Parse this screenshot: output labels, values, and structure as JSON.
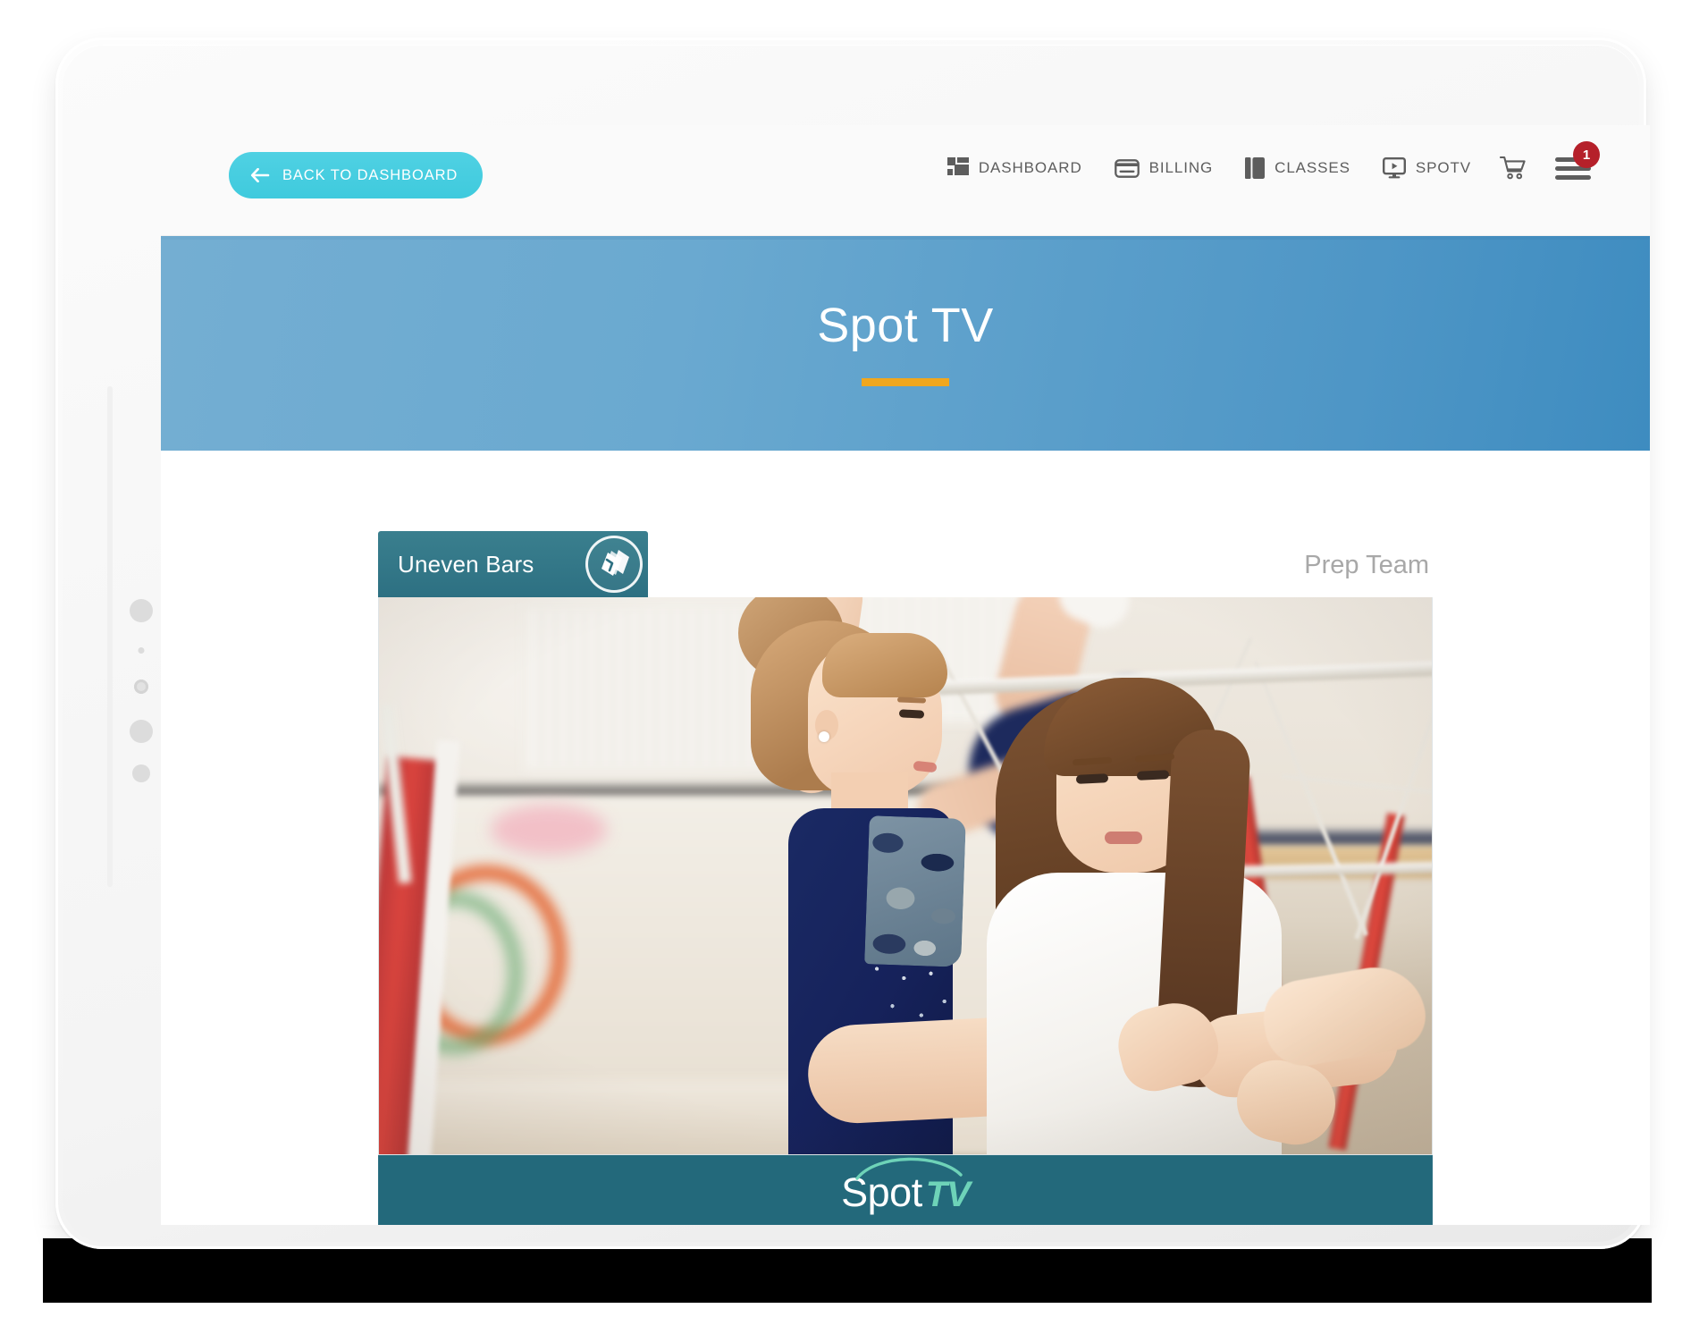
{
  "device": {
    "type": "tablet",
    "side_buttons": [
      "power-dot",
      "mic-dot",
      "camera-dot",
      "volume-up-dot",
      "volume-down-dot"
    ]
  },
  "topnav": {
    "back_button": {
      "label": "BACK TO DASHBOARD",
      "icon": "arrow-left-icon",
      "bg_color": "#43ccdf",
      "text_color": "#ffffff"
    },
    "items": [
      {
        "label": "DASHBOARD",
        "icon": "grid-dashboard-icon"
      },
      {
        "label": "BILLING",
        "icon": "credit-card-icon"
      },
      {
        "label": "CLASSES",
        "icon": "book-classes-icon"
      },
      {
        "label": "SPOTV",
        "icon": "monitor-play-icon"
      }
    ],
    "cart": {
      "icon": "shopping-cart-icon"
    },
    "menu": {
      "icon": "hamburger-menu-icon",
      "badge_count": "1",
      "badge_color": "#b5202a"
    },
    "text_color": "#5d5d5d",
    "bg_color": "#fafafa"
  },
  "banner": {
    "title": "Spot TV",
    "gradient_from": "#74aed2",
    "gradient_to": "#3e8cc0",
    "rule_color": "#f0a71e"
  },
  "video_card": {
    "category": {
      "label": "Uneven Bars",
      "icon": "stacked-cards-icon",
      "bg_color": "#2d7082",
      "text_color": "#ffffff"
    },
    "team": {
      "label": "Prep Team",
      "text_color": "#a8a8a8"
    },
    "thumbnail": {
      "alt": "Gymnastics coach stretching a young gymnast's leg in front of uneven bars",
      "subjects": [
        "young-gymnast",
        "coach"
      ]
    },
    "footer": {
      "logo_primary": "Spot",
      "logo_accent": "TV",
      "bg_color": "#23697b",
      "primary_color": "#ffffff",
      "accent_color": "#6ed3b8",
      "swoosh_icon": "arc-swoosh-icon"
    }
  }
}
